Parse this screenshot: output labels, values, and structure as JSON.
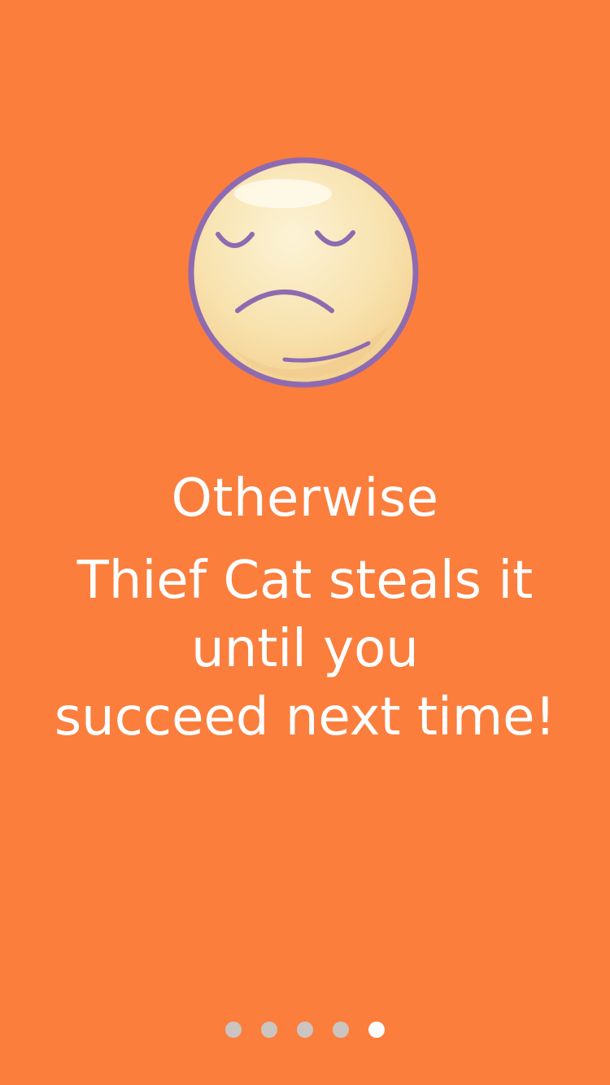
{
  "screen": {
    "background_color": "#FB7E3D",
    "icon": "sad-face-icon",
    "heading": "Otherwise",
    "body_lines": [
      "Thief Cat steals it",
      "until you",
      "succeed next time!"
    ]
  },
  "pager": {
    "total_pages": 5,
    "active_page": 5,
    "active_color": "#FFFFFF",
    "inactive_color": "#C8C8C8"
  }
}
